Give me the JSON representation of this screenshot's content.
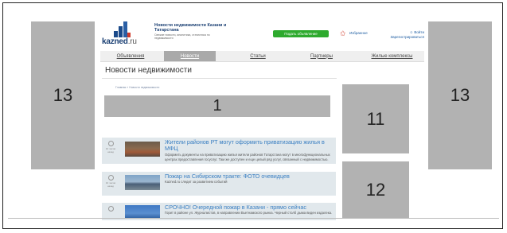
{
  "header": {
    "logo_text": "kazned",
    "logo_suffix": ".ru",
    "site_title": "Новости недвижимости Казани и Татарстана",
    "site_subtitle": "Свежие новости, аналитика, статистика по недвижимости",
    "submit_button": "Подать объявление",
    "favorites_label": "Избранное",
    "login_label": "Войти",
    "register_label": "Зарегистрироваться"
  },
  "nav": {
    "items": [
      {
        "label": "Объявления"
      },
      {
        "label": "Новости"
      },
      {
        "label": "Статьи"
      },
      {
        "label": "Партнеры"
      },
      {
        "label": "Жилые комплексы"
      }
    ],
    "active_index": 1
  },
  "page": {
    "title": "Новости недвижимости",
    "breadcrumb": "Главная  »  Новости недвижимости"
  },
  "ads": {
    "left": "13",
    "right": "13",
    "top_banner": "1",
    "side_top": "11",
    "side_bottom": "12"
  },
  "news": [
    {
      "time": "10 часов назад",
      "title": "Жители районов РТ могут оформить приватизацию жилья в МФЦ",
      "description": "Оформить документы на приватизацию жилья жители районов Татарстана могут в многофункциональных центрах предоставления госуслуг. Там же доступен и еще целый ряд услуг, связанный с недвижимостью."
    },
    {
      "time": "10 часов назад",
      "title": "Пожар на Сибирском тракте: ФОТО очевидцев",
      "description": "Kazned.ru следит за развитием событий"
    },
    {
      "time": "",
      "title": "СРОЧНО! Очередной пожар в Казани - прямо сейчас",
      "description": "Горит в районе ул. Журналистов, в направлении Вьетнамского рынка. Черный столб дыма виден издалека."
    }
  ],
  "colors": {
    "brand_blue": "#1a3f73",
    "link_blue": "#3a7fc2",
    "submit_green": "#2eaa2e",
    "ad_gray": "#b2b2b2",
    "news_bg": "#e1e8ec"
  }
}
